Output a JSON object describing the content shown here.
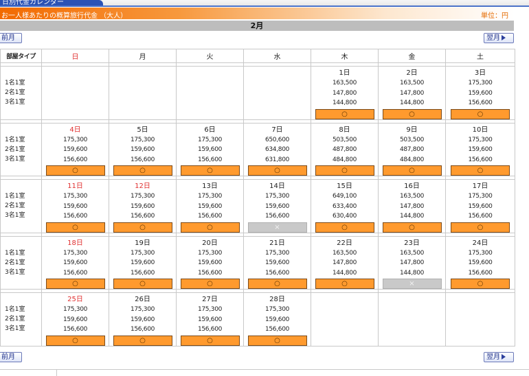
{
  "header": {
    "tab_title": "日別代金カレンダー",
    "title": "お一人様あたりの概算旅行代金 （大人）",
    "unit": "単位：円"
  },
  "month": "2月",
  "nav": {
    "prev": "前月",
    "next": "翌月"
  },
  "columns": [
    "部屋タイプ",
    "日",
    "月",
    "火",
    "水",
    "木",
    "金",
    "土"
  ],
  "room_types": [
    "1名1室",
    "2名1室",
    "3名1室"
  ],
  "avail_symbols": {
    "ok": "○",
    "ng": "×"
  },
  "weeks": [
    [
      null,
      null,
      null,
      null,
      {
        "date": "1日",
        "prices": [
          "163,500",
          "147,800",
          "144,800"
        ],
        "available": true
      },
      {
        "date": "2日",
        "prices": [
          "163,500",
          "147,800",
          "144,800"
        ],
        "available": true
      },
      {
        "date": "3日",
        "prices": [
          "175,300",
          "159,600",
          "156,600"
        ],
        "available": true
      }
    ],
    [
      {
        "date": "4日",
        "red": true,
        "prices": [
          "175,300",
          "159,600",
          "156,600"
        ],
        "available": true
      },
      {
        "date": "5日",
        "prices": [
          "175,300",
          "159,600",
          "156,600"
        ],
        "available": true
      },
      {
        "date": "6日",
        "prices": [
          "175,300",
          "159,600",
          "156,600"
        ],
        "available": true
      },
      {
        "date": "7日",
        "prices": [
          "650,600",
          "634,800",
          "631,800"
        ],
        "available": true
      },
      {
        "date": "8日",
        "prices": [
          "503,500",
          "487,800",
          "484,800"
        ],
        "available": true
      },
      {
        "date": "9日",
        "prices": [
          "503,500",
          "487,800",
          "484,800"
        ],
        "available": true
      },
      {
        "date": "10日",
        "prices": [
          "175,300",
          "159,600",
          "156,600"
        ],
        "available": true
      }
    ],
    [
      {
        "date": "11日",
        "red": true,
        "prices": [
          "175,300",
          "159,600",
          "156,600"
        ],
        "available": true
      },
      {
        "date": "12日",
        "red": true,
        "prices": [
          "175,300",
          "159,600",
          "156,600"
        ],
        "available": true
      },
      {
        "date": "13日",
        "prices": [
          "175,300",
          "159,600",
          "156,600"
        ],
        "available": true
      },
      {
        "date": "14日",
        "prices": [
          "175,300",
          "159,600",
          "156,600"
        ],
        "available": false
      },
      {
        "date": "15日",
        "prices": [
          "649,100",
          "633,400",
          "630,400"
        ],
        "available": true
      },
      {
        "date": "16日",
        "prices": [
          "163,500",
          "147,800",
          "144,800"
        ],
        "available": true
      },
      {
        "date": "17日",
        "prices": [
          "175,300",
          "159,600",
          "156,600"
        ],
        "available": true
      }
    ],
    [
      {
        "date": "18日",
        "red": true,
        "prices": [
          "175,300",
          "159,600",
          "156,600"
        ],
        "available": true
      },
      {
        "date": "19日",
        "prices": [
          "175,300",
          "159,600",
          "156,600"
        ],
        "available": true
      },
      {
        "date": "20日",
        "prices": [
          "175,300",
          "159,600",
          "156,600"
        ],
        "available": true
      },
      {
        "date": "21日",
        "prices": [
          "175,300",
          "159,600",
          "156,600"
        ],
        "available": true
      },
      {
        "date": "22日",
        "prices": [
          "163,500",
          "147,800",
          "144,800"
        ],
        "available": true
      },
      {
        "date": "23日",
        "prices": [
          "163,500",
          "147,800",
          "144,800"
        ],
        "available": false
      },
      {
        "date": "24日",
        "prices": [
          "175,300",
          "159,600",
          "156,600"
        ],
        "available": true
      }
    ],
    [
      {
        "date": "25日",
        "red": true,
        "prices": [
          "175,300",
          "159,600",
          "156,600"
        ],
        "available": true
      },
      {
        "date": "26日",
        "prices": [
          "175,300",
          "159,600",
          "156,600"
        ],
        "available": true
      },
      {
        "date": "27日",
        "prices": [
          "175,300",
          "159,600",
          "156,600"
        ],
        "available": true
      },
      {
        "date": "28日",
        "prices": [
          "175,300",
          "159,600",
          "156,600"
        ],
        "available": true
      },
      null,
      null,
      null
    ]
  ],
  "colors": {
    "orange": "#ff9a2e",
    "sunday_red": "#e03030",
    "tab_blue": "#2b52b5"
  }
}
